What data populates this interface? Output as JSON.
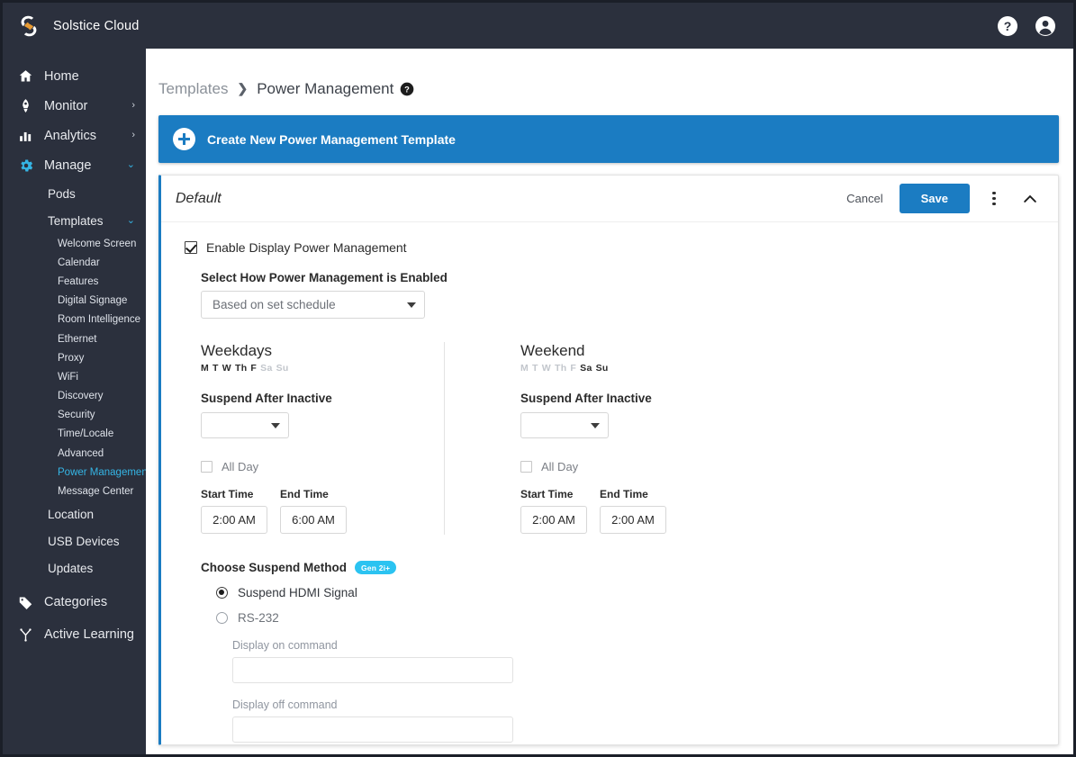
{
  "app": {
    "brand": "Solstice Cloud",
    "logo_icon": "solstice-logo",
    "help_icon": "help-circle-icon",
    "account_icon": "account-circle-icon"
  },
  "sidebar": {
    "items": [
      {
        "label": "Home",
        "icon": "home-icon",
        "caret": ""
      },
      {
        "label": "Monitor",
        "icon": "rocket-icon",
        "caret": "›"
      },
      {
        "label": "Analytics",
        "icon": "bar-chart-icon",
        "caret": "›"
      },
      {
        "label": "Manage",
        "icon": "gear-icon",
        "caret": "⌄"
      }
    ],
    "manage_children": [
      {
        "label": "Pods"
      },
      {
        "label": "Templates",
        "caret": "⌄"
      }
    ],
    "template_children": [
      {
        "label": "Welcome Screen",
        "active": false
      },
      {
        "label": "Calendar",
        "active": false
      },
      {
        "label": "Features",
        "active": false
      },
      {
        "label": "Digital Signage",
        "active": false
      },
      {
        "label": "Room Intelligence",
        "active": false
      },
      {
        "label": "Ethernet",
        "active": false
      },
      {
        "label": "Proxy",
        "active": false
      },
      {
        "label": "WiFi",
        "active": false
      },
      {
        "label": "Discovery",
        "active": false
      },
      {
        "label": "Security",
        "active": false
      },
      {
        "label": "Time/Locale",
        "active": false
      },
      {
        "label": "Advanced",
        "active": false
      },
      {
        "label": "Power Management",
        "active": true
      },
      {
        "label": "Message Center",
        "active": false
      }
    ],
    "manage_tail": [
      {
        "label": "Location"
      },
      {
        "label": "USB Devices"
      },
      {
        "label": "Updates"
      }
    ],
    "bottom_items": [
      {
        "label": "Categories",
        "icon": "tag-icon"
      },
      {
        "label": "Active Learning",
        "icon": "active-learning-icon"
      }
    ]
  },
  "breadcrumb": {
    "parent": "Templates",
    "separator": "❯",
    "current": "Power Management",
    "help_icon": "help-circle-icon"
  },
  "banner": {
    "label": "Create New Power Management Template",
    "icon": "plus-circle-icon"
  },
  "card": {
    "title": "Default",
    "cancel_label": "Cancel",
    "save_label": "Save",
    "menu_icon": "kebab-menu-icon",
    "collapse_icon": "chevron-up-icon",
    "enable_checkbox": {
      "label": "Enable Display Power Management",
      "checked": true
    },
    "mode": {
      "label": "Select How Power Management is Enabled",
      "value": "Based on set schedule"
    },
    "schedules": [
      {
        "title": "Weekdays",
        "days_on": [
          "M",
          "T",
          "W",
          "Th",
          "F"
        ],
        "days_off": [
          "Sa",
          "Su"
        ],
        "suspend_label": "Suspend After Inactive",
        "suspend_value": "",
        "all_day_label": "All Day",
        "all_day_checked": false,
        "start_label": "Start Time",
        "start_value": "2:00 AM",
        "end_label": "End Time",
        "end_value": "6:00 AM"
      },
      {
        "title": "Weekend",
        "days_on": [
          "Sa",
          "Su"
        ],
        "days_off": [
          "M",
          "T",
          "W",
          "Th",
          "F"
        ],
        "suspend_label": "Suspend After Inactive",
        "suspend_value": "",
        "all_day_label": "All Day",
        "all_day_checked": false,
        "start_label": "Start Time",
        "start_value": "2:00 AM",
        "end_label": "End Time",
        "end_value": "2:00 AM"
      }
    ],
    "suspend_method": {
      "title": "Choose Suspend Method",
      "badge": "Gen 2i+",
      "options": [
        {
          "label": "Suspend HDMI Signal",
          "selected": true
        },
        {
          "label": "RS-232",
          "selected": false
        }
      ],
      "display_on_label": "Display on command",
      "display_on_value": "",
      "display_off_label": "Display off command",
      "display_off_value": ""
    }
  },
  "colors": {
    "sidebar_bg": "#2b303d",
    "accent_blue": "#1b7cc2",
    "accent_cyan": "#35b5e5",
    "badge_cyan": "#2bc3f1",
    "logo_orange": "#e89a32"
  }
}
